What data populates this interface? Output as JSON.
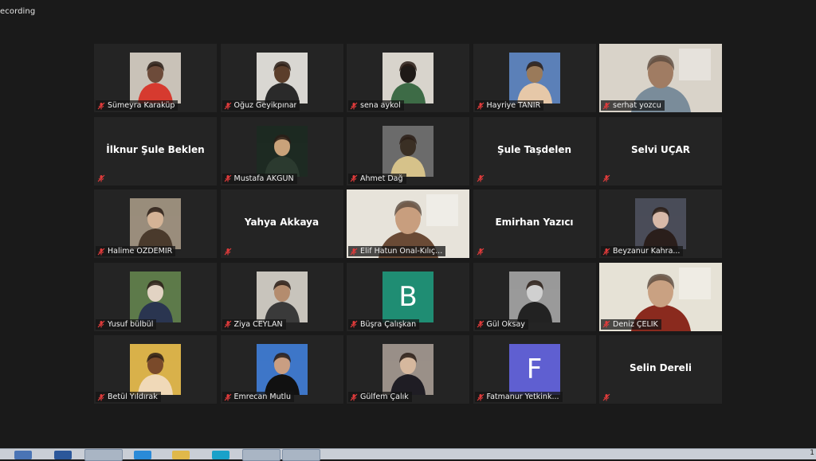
{
  "window": {
    "recording_label": "ecording"
  },
  "participants": [
    {
      "name": "Sümeyra Karaküp",
      "kind": "photo",
      "palette": [
        "#c9c2b8",
        "#d63a2f",
        "#6d4b3a"
      ]
    },
    {
      "name": "Oğuz Geyikpınar",
      "kind": "photo",
      "palette": [
        "#d9d7d2",
        "#2a2a2a",
        "#5b3e2b"
      ]
    },
    {
      "name": "sena aykol",
      "kind": "photo",
      "palette": [
        "#d8d4cc",
        "#3d6b46",
        "#1e1a17"
      ]
    },
    {
      "name": "Hayriye TANIR",
      "kind": "photo",
      "palette": [
        "#5b80b8",
        "#e6c8a8",
        "#9a7a5a"
      ]
    },
    {
      "name": "serhat yozcu",
      "kind": "video",
      "palette": [
        "#d9d3c9",
        "#7a8c9a",
        "#a07c63"
      ]
    },
    {
      "name": "İlknur Şule Beklen",
      "kind": "name"
    },
    {
      "name": "Mustafa AKGÜN",
      "kind": "photo",
      "palette": [
        "#1d2a22",
        "#2b3a2f",
        "#c9a27a"
      ]
    },
    {
      "name": "Ahmet Dağ",
      "kind": "photo",
      "palette": [
        "#6b6b6b",
        "#d6c28a",
        "#3a2f24"
      ]
    },
    {
      "name": "Şule Taşdelen",
      "kind": "name"
    },
    {
      "name": "Selvi UÇAR",
      "kind": "name"
    },
    {
      "name": "Halime ÖZDEMİR",
      "kind": "photo",
      "palette": [
        "#9a8d7c",
        "#4a3a2c",
        "#d4b396"
      ]
    },
    {
      "name": "Yahya Akkaya",
      "kind": "name"
    },
    {
      "name": "Elif Hatun Onal-Kılıç...",
      "kind": "video",
      "palette": [
        "#e7e3da",
        "#6a4a35",
        "#c89e7e"
      ]
    },
    {
      "name": "Emirhan Yazıcı",
      "kind": "name"
    },
    {
      "name": "Beyzanur Kahra...",
      "kind": "photo",
      "palette": [
        "#4a4c58",
        "#2a1e1b",
        "#d8b9a8"
      ]
    },
    {
      "name": "Yusuf bülbül",
      "kind": "photo",
      "palette": [
        "#5d7a4a",
        "#2a3550",
        "#e2d3c3"
      ]
    },
    {
      "name": "Ziya CEYLAN",
      "kind": "photo",
      "palette": [
        "#c8c4bc",
        "#3a3a3a",
        "#b48c6e"
      ]
    },
    {
      "name": "Büşra Çalışkan",
      "kind": "letter",
      "letter": "B",
      "color": "#1f8d73"
    },
    {
      "name": "Gül Oksay",
      "kind": "photo",
      "palette": [
        "#9a9a9a",
        "#222222",
        "#d0d0d0"
      ]
    },
    {
      "name": "Deniz ÇELİK",
      "kind": "video",
      "palette": [
        "#e6e2d6",
        "#8a2a1e",
        "#c9a182"
      ]
    },
    {
      "name": "Betül Yıldırak",
      "kind": "photo",
      "palette": [
        "#d9b14a",
        "#f0d9b8",
        "#7a4a2a"
      ]
    },
    {
      "name": "Emrecan Mutlu",
      "kind": "photo",
      "palette": [
        "#3e76c8",
        "#111111",
        "#c99e82"
      ]
    },
    {
      "name": "Gülfem Çalık",
      "kind": "photo",
      "palette": [
        "#9a9088",
        "#1f1d24",
        "#d6b89e"
      ]
    },
    {
      "name": "Fatmanur Yetkink...",
      "kind": "letter",
      "letter": "F",
      "color": "#5f5fd1"
    },
    {
      "name": "Selin Dereli",
      "kind": "name"
    }
  ],
  "taskbar": {
    "clock_fragment": "1"
  }
}
